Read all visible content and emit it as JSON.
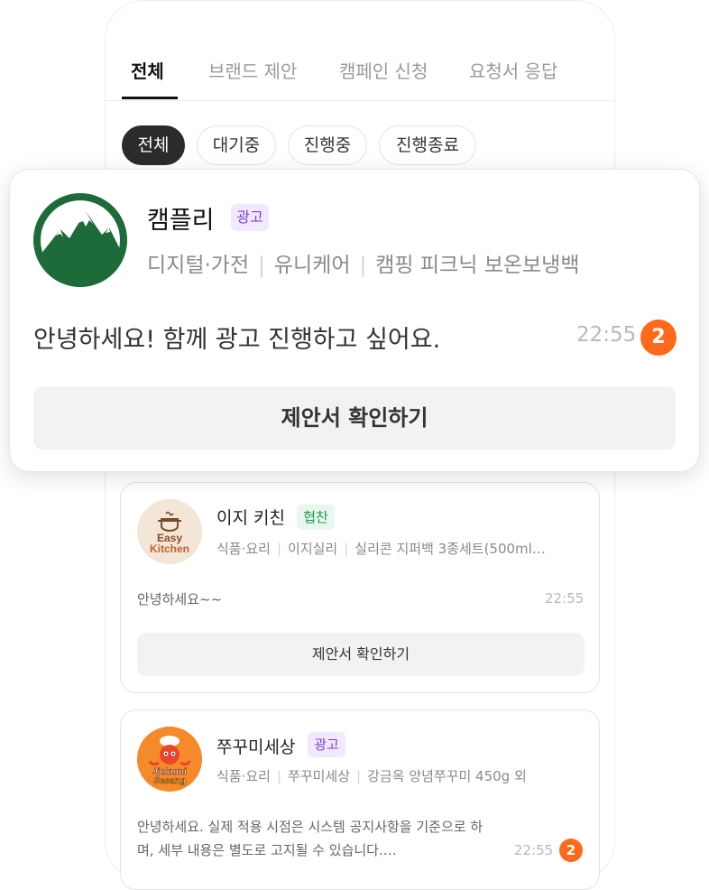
{
  "tabs": [
    {
      "label": "전체",
      "active": true
    },
    {
      "label": "브랜드 제안",
      "active": false
    },
    {
      "label": "캠페인 신청",
      "active": false
    },
    {
      "label": "요청서 응답",
      "active": false
    }
  ],
  "filters": [
    {
      "label": "전체",
      "active": true
    },
    {
      "label": "대기중",
      "active": false
    },
    {
      "label": "진행중",
      "active": false
    },
    {
      "label": "진행종료",
      "active": false
    }
  ],
  "featured": {
    "brand": "캠플리",
    "badge": "광고",
    "tags": [
      "디지털·가전",
      "유니케어",
      "캠핑 피크닉 보온보냉백"
    ],
    "message": "안녕하세요! 함께 광고 진행하고 싶어요.",
    "time": "22:55",
    "unread": "2",
    "button": "제안서 확인하기",
    "logo_color": "#1e6b3a"
  },
  "cards": [
    {
      "brand": "이지 키친",
      "badge": "협찬",
      "badge_type": "sponsor",
      "tags": [
        "식품·요리",
        "이지실리",
        "실리콘 지퍼백 3종세트(500ml…"
      ],
      "message": "안녕하세요~~",
      "time": "22:55",
      "unread": "",
      "button": "제안서 확인하기",
      "logo_text": [
        "Easy",
        "Kitchen"
      ]
    },
    {
      "brand": "쭈꾸미세상",
      "badge": "광고",
      "badge_type": "ad",
      "tags": [
        "식품·요리",
        "쭈꾸미세상",
        "강금옥 양념쭈꾸미 450g 외"
      ],
      "message": "안녕하세요. 실제 적용 시점은 시스템 공지사항을 기준으로 하며, 세부 내용은 별도로 고지될 수 있습니다.…",
      "time": "22:55",
      "unread": "2",
      "logo_text": [
        "Jjukumi",
        "Sesang"
      ]
    }
  ],
  "colors": {
    "accent": "#ff6a1a",
    "ad_badge": "#7b3fd4",
    "sponsor_badge": "#1d9a4f"
  }
}
